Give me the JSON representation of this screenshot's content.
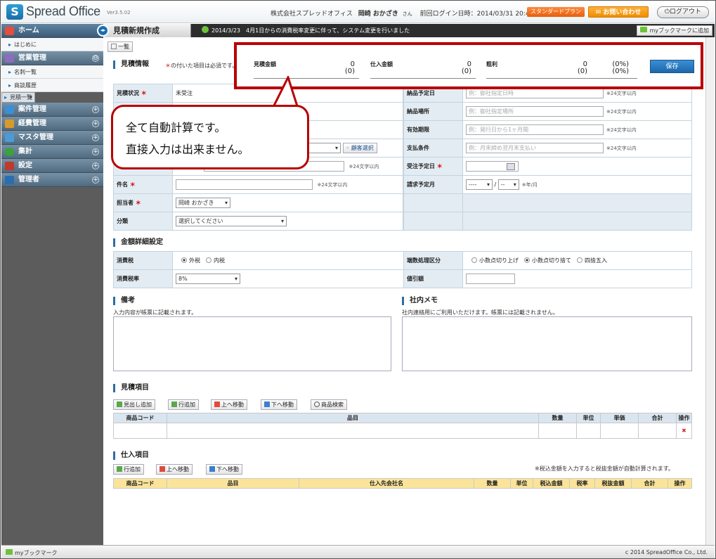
{
  "header": {
    "logo_mark": "S",
    "app_name": "Spread Office",
    "version": "Ver3.5.02",
    "company": "株式会社スプレッドオフィス",
    "user": "岡崎 おかざき",
    "honorific": "さん",
    "last_login": "前回ログイン日時：2014/03/31 20:44:09",
    "plan": "スタンダードプラン",
    "contact": "お問い合わせ",
    "logout": "ログアウト"
  },
  "sidebar": {
    "home": "ホーム",
    "intro": "はじめに",
    "sales": "営業管理",
    "sales_items": [
      "名刺一覧",
      "商談履歴",
      "見積一覧"
    ],
    "others": [
      "案件管理",
      "経費管理",
      "マスタ管理",
      "集計",
      "設定",
      "管理者"
    ]
  },
  "titlebar": {
    "title": "見積新規作成",
    "notice": "2014/3/23　4月1日からの消費税率変更に伴って、システム変更を行いました",
    "bookmark_add": "myブックマークに追加"
  },
  "list_button": "一覧",
  "quote_info": {
    "title": "見積情報",
    "req_mark": "＊",
    "req_note": "の付いた項目は必須です。"
  },
  "summary": {
    "quote_amount_label": "見積金額",
    "quote_amount": "0",
    "quote_amount_sub": "(0)",
    "purchase_label": "仕入金額",
    "purchase_amount": "0",
    "purchase_sub": "(0)",
    "gross_label": "粗利",
    "gross_amount": "0",
    "gross_sub": "(0)",
    "gross_pct": "(0%)",
    "gross_pct_sub": "(0%)",
    "save": "保存"
  },
  "callout": {
    "line1": "全て自動計算です。",
    "line2": "直接入力は出来ません。"
  },
  "form": {
    "status_label": "見積状況",
    "status_value": "未受注",
    "customer_select": "顧客選択",
    "note24": "※24文字以内",
    "note24b": "※24文字以内",
    "subject_label": "件名",
    "subject_note": "※24文字以内",
    "person_label": "担当者",
    "person_value": "岡崎 おかざき",
    "category_label": "分類",
    "category_value": "選択してください",
    "delivery_date_label": "納品予定日",
    "delivery_date_ph": "例：御社指定日時",
    "delivery_date_note": "※24文字以内",
    "delivery_place_label": "納品場所",
    "delivery_place_ph": "例：御社指定場所",
    "delivery_place_note": "※24文字以内",
    "validity_label": "有効期限",
    "validity_ph": "例：発行日から1ヶ月間",
    "validity_note": "※24文字以内",
    "payment_label": "支払条件",
    "payment_ph": "例：月末締め翌月末支払い",
    "payment_note": "※24文字以内",
    "order_date_label": "受注予定日",
    "billing_month_label": "請求予定月",
    "year_sel": "----",
    "slash": "/",
    "month_sel": "--",
    "ym_note": "※年/月"
  },
  "amount_detail": {
    "title": "金額詳細設定",
    "tax_label": "消費税",
    "tax_opt1": "外税",
    "tax_opt2": "内税",
    "rate_label": "消費税率",
    "rate_value": "8%",
    "rounding_label": "端数処理区分",
    "round1": "小数点切り上げ",
    "round2": "小数点切り捨て",
    "round3": "四捨五入",
    "discount_label": "値引額"
  },
  "remarks": {
    "title": "備考",
    "hint": "入力内容が帳票に記載されます。"
  },
  "memo": {
    "title": "社内メモ",
    "hint": "社内連絡用にご利用いただけます。帳票には記載されません。"
  },
  "quote_items": {
    "title": "見積項目",
    "buttons": [
      "見出し追加",
      "行追加",
      "上へ移動",
      "下へ移動",
      "商品検索"
    ],
    "columns": [
      "商品コード",
      "品目",
      "数量",
      "単位",
      "単価",
      "合計",
      "操作"
    ]
  },
  "purchase_items": {
    "title": "仕入項目",
    "buttons": [
      "行追加",
      "上へ移動",
      "下へ移動"
    ],
    "note": "※税込金額を入力すると税抜金額が自動計算されます。",
    "columns": [
      "商品コード",
      "品目",
      "仕入先会社名",
      "数量",
      "単位",
      "税込金額",
      "税率",
      "税抜金額",
      "合計",
      "操作"
    ]
  },
  "footer": {
    "bookmark": "myブックマーク",
    "copyright": "c 2014 SpreadOffice Co., Ltd."
  }
}
